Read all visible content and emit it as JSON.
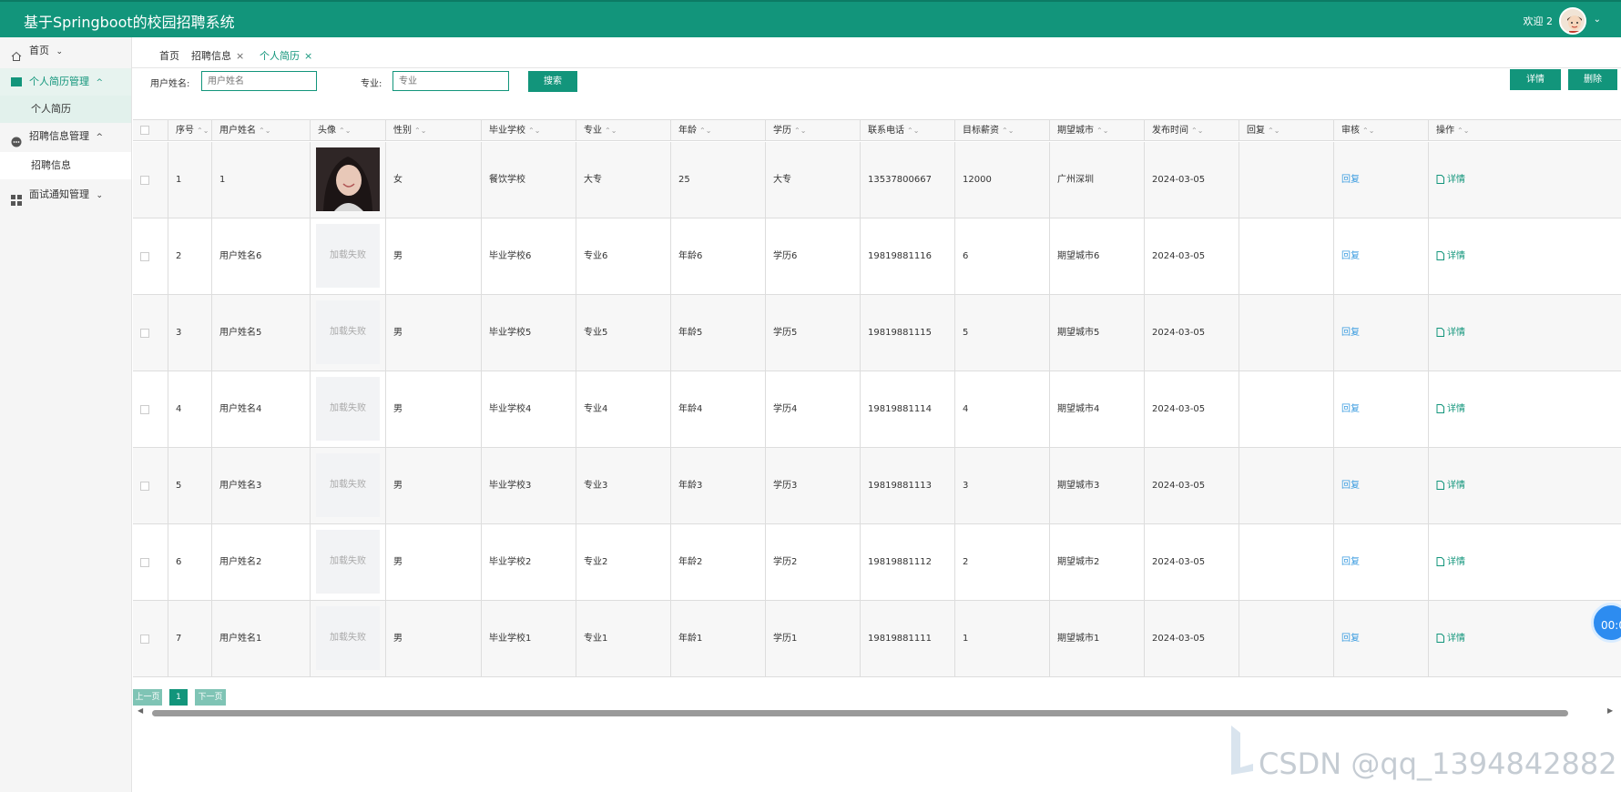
{
  "header": {
    "app_title": "基于Springboot的校园招聘系统",
    "welcome": "欢迎 2",
    "chevron": "⌄"
  },
  "sidebar": {
    "items": [
      {
        "label": "首页",
        "icon": "home-icon",
        "arrow": "⌄"
      },
      {
        "label": "个人简历管理",
        "icon": "resume-icon",
        "arrow": "^",
        "active": true
      },
      {
        "label": "个人简历",
        "sub": true,
        "active": true
      },
      {
        "label": "招聘信息管理",
        "icon": "chat-icon",
        "arrow": "^"
      },
      {
        "label": "招聘信息",
        "sub": true
      },
      {
        "label": "面试通知管理",
        "icon": "grid-icon",
        "arrow": "⌄"
      }
    ]
  },
  "tabs": {
    "home": "首页",
    "recruit": "招聘信息",
    "resume": "个人简历",
    "close": "×"
  },
  "filters": {
    "username_label": "用户姓名:",
    "username_placeholder": "用户姓名",
    "major_label": "专业:",
    "major_placeholder": "专业",
    "search_label": "搜索"
  },
  "actions": {
    "detail_label": "详情",
    "delete_label": "删除"
  },
  "table": {
    "columns": [
      "序号",
      "用户姓名",
      "头像",
      "性别",
      "毕业学校",
      "专业",
      "年龄",
      "学历",
      "联系电话",
      "目标薪资",
      "期望城市",
      "发布时间",
      "回复",
      "审核",
      "操作"
    ],
    "sort_glyph": "⌃⌄",
    "img_fail_text": "加载失败",
    "reply_link": "回复",
    "detail_link": "详情",
    "rows": [
      {
        "no": "1",
        "name": "1",
        "gender": "女",
        "school": "餐饮学校",
        "major": "大专",
        "age": "25",
        "edu": "大专",
        "phone": "13537800667",
        "salary": "12000",
        "city": "广州深圳",
        "time": "2024-03-05",
        "reply": "",
        "has_photo": true
      },
      {
        "no": "2",
        "name": "用户姓名6",
        "gender": "男",
        "school": "毕业学校6",
        "major": "专业6",
        "age": "年龄6",
        "edu": "学历6",
        "phone": "19819881116",
        "salary": "6",
        "city": "期望城市6",
        "time": "2024-03-05",
        "reply": ""
      },
      {
        "no": "3",
        "name": "用户姓名5",
        "gender": "男",
        "school": "毕业学校5",
        "major": "专业5",
        "age": "年龄5",
        "edu": "学历5",
        "phone": "19819881115",
        "salary": "5",
        "city": "期望城市5",
        "time": "2024-03-05",
        "reply": ""
      },
      {
        "no": "4",
        "name": "用户姓名4",
        "gender": "男",
        "school": "毕业学校4",
        "major": "专业4",
        "age": "年龄4",
        "edu": "学历4",
        "phone": "19819881114",
        "salary": "4",
        "city": "期望城市4",
        "time": "2024-03-05",
        "reply": ""
      },
      {
        "no": "5",
        "name": "用户姓名3",
        "gender": "男",
        "school": "毕业学校3",
        "major": "专业3",
        "age": "年龄3",
        "edu": "学历3",
        "phone": "19819881113",
        "salary": "3",
        "city": "期望城市3",
        "time": "2024-03-05",
        "reply": ""
      },
      {
        "no": "6",
        "name": "用户姓名2",
        "gender": "男",
        "school": "毕业学校2",
        "major": "专业2",
        "age": "年龄2",
        "edu": "学历2",
        "phone": "19819881112",
        "salary": "2",
        "city": "期望城市2",
        "time": "2024-03-05",
        "reply": ""
      },
      {
        "no": "7",
        "name": "用户姓名1",
        "gender": "男",
        "school": "毕业学校1",
        "major": "专业1",
        "age": "年龄1",
        "edu": "学历1",
        "phone": "19819881111",
        "salary": "1",
        "city": "期望城市1",
        "time": "2024-03-05",
        "reply": ""
      }
    ]
  },
  "pager": {
    "prev": "上一页",
    "current": "1",
    "next": "下一页"
  },
  "float_button": "00:0",
  "watermark": "CSDN @qq_1394842882",
  "colors": {
    "brand": "#12957b",
    "link_blue": "#3d9de0"
  }
}
